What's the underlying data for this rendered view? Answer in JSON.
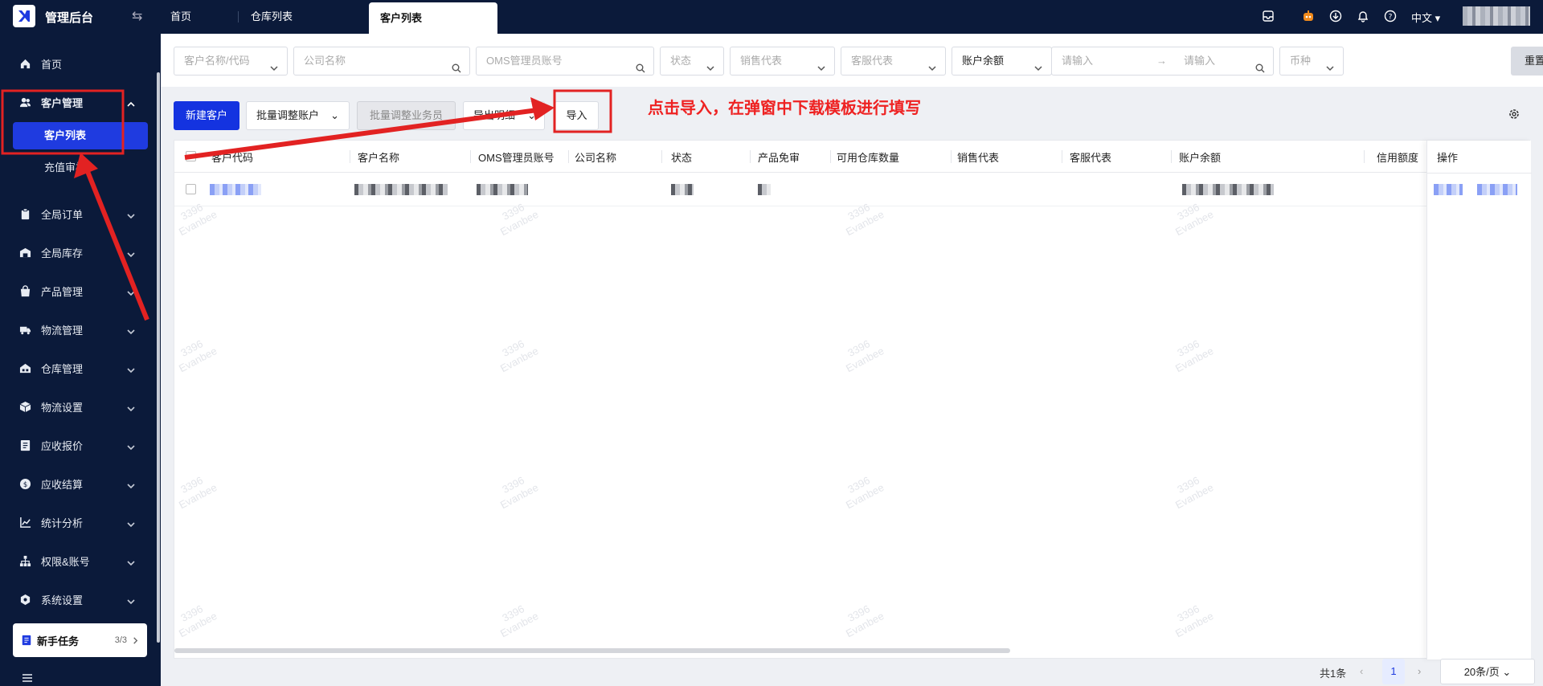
{
  "header": {
    "app_title": "管理后台",
    "tabs": [
      {
        "label": "首页"
      },
      {
        "label": "仓库列表"
      },
      {
        "label": "客户列表"
      }
    ],
    "language": "中文"
  },
  "sidebar": {
    "items": [
      {
        "label": "首页",
        "icon": "home-icon"
      },
      {
        "label": "客户管理",
        "icon": "users-icon",
        "expanded": true,
        "children": [
          {
            "label": "客户列表",
            "active": true
          },
          {
            "label": "充值审核"
          }
        ]
      },
      {
        "label": "全局订单",
        "icon": "clipboard-icon"
      },
      {
        "label": "全局库存",
        "icon": "warehouse-icon"
      },
      {
        "label": "产品管理",
        "icon": "bag-icon"
      },
      {
        "label": "物流管理",
        "icon": "truck-icon"
      },
      {
        "label": "仓库管理",
        "icon": "building-icon"
      },
      {
        "label": "物流设置",
        "icon": "box-icon"
      },
      {
        "label": "应收报价",
        "icon": "document-icon"
      },
      {
        "label": "应收结算",
        "icon": "coin-icon"
      },
      {
        "label": "统计分析",
        "icon": "chart-icon"
      },
      {
        "label": "权限&账号",
        "icon": "hierarchy-icon"
      },
      {
        "label": "系统设置",
        "icon": "hexagon-icon"
      }
    ],
    "task": {
      "label": "新手任务",
      "count": "3/3"
    }
  },
  "filters": {
    "customer": "客户名称/代码",
    "company": "公司名称",
    "oms_account": "OMS管理员账号",
    "status": "状态",
    "sales_rep": "销售代表",
    "service_rep": "客服代表",
    "balance_select": "账户余额",
    "range_from": "请输入",
    "range_to": "请输入",
    "currency": "币种",
    "reset": "重置"
  },
  "toolbar": {
    "new_customer": "新建客户",
    "batch_adjust": "批量调整账户",
    "batch_salesman": "批量调整业务员",
    "export": "导出明细",
    "import": "导入"
  },
  "annotation": {
    "text": "点击导入，在弹窗中下载模板进行填写"
  },
  "table": {
    "columns": [
      "客户代码",
      "客户名称",
      "OMS管理员账号",
      "公司名称",
      "状态",
      "产品免审",
      "可用仓库数量",
      "销售代表",
      "客服代表",
      "账户余额",
      "信用额度",
      "操作"
    ]
  },
  "watermark": {
    "line1": "3396",
    "line2": "Evanbee"
  },
  "pagination": {
    "total": "共1条",
    "current_page": "1",
    "page_size": "20条/页"
  },
  "colors": {
    "sidebar_bg": "#0b1a3a",
    "primary": "#1433e0",
    "annotation_red": "#e22222"
  }
}
